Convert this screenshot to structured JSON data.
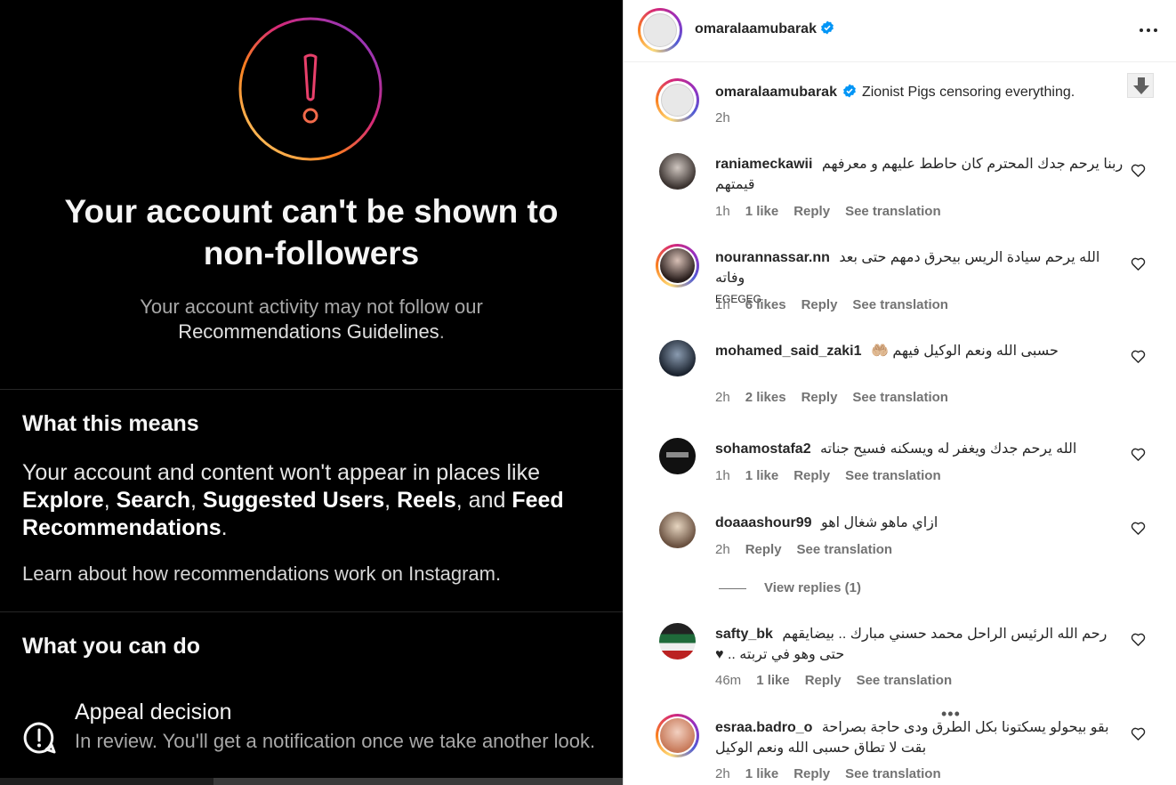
{
  "left": {
    "title": "Your account can't be shown to non-followers",
    "subtitle_prefix": "Your account activity may not follow our",
    "subtitle_link": "Recommendations Guidelines",
    "subtitle_suffix": ".",
    "means_heading": "What this means",
    "means_body_prefix": "Your account and content won't appear in places like",
    "means_places": [
      "Explore",
      "Search",
      "Suggested Users",
      "Reels",
      "Feed Recommendations"
    ],
    "means_sep1": ", ",
    "means_and": ", and ",
    "means_end": ".",
    "learn_text": "Learn about how recommendations work on Instagram.",
    "cando_heading": "What you can do",
    "appeal_title": "Appeal decision",
    "appeal_desc": "In review. You'll get a notification once we take another look."
  },
  "post": {
    "author": "omaralaamubarak",
    "caption": "Zionist Pigs censoring everything.",
    "time": "2h"
  },
  "comments": [
    {
      "user": "raniameckawii",
      "text": "ربنا يرحم جدك المحترم كان حاطط عليهم و معرفهم قيمتهم",
      "time": "1h",
      "likes": "1 like",
      "reply": "Reply",
      "translate": "See translation"
    },
    {
      "user": "nourannassar.nn",
      "text": "الله يرحم سيادة الريس بيحرق دمهم حتى بعد وفاته",
      "tail": "EGEGEG",
      "time": "1h",
      "likes": "6 likes",
      "reply": "Reply",
      "translate": "See translation"
    },
    {
      "user": "mohamed_said_zaki1",
      "text": "حسبى الله ونعم الوكيل فيهم",
      "emoji": "🤲🏼",
      "time": "2h",
      "likes": "2 likes",
      "reply": "Reply",
      "translate": "See translation"
    },
    {
      "user": "sohamostafa2",
      "text": "الله يرحم جدك ويغفر له ويسكنه فسيح جناته",
      "time": "1h",
      "likes": "1 like",
      "reply": "Reply",
      "translate": "See translation"
    },
    {
      "user": "doaaashour99",
      "text": "ازاي ماهو شغال اهو",
      "time": "2h",
      "reply": "Reply",
      "translate": "See translation"
    },
    {
      "user": "safty_bk",
      "text": "رحم الله الرئيس الراحل محمد حسني مبارك .. بيضايقهم حتى وهو في تربته .. ♥",
      "time": "46m",
      "likes": "1 like",
      "reply": "Reply",
      "translate": "See translation"
    },
    {
      "user": "esraa.badro_o",
      "text": "بقو بيحولو يسكتونا بكل الطرق ودى حاجة بصراحة بقت لا تطاق حسبى الله ونعم الوكيل",
      "time": "2h",
      "likes": "1 like",
      "reply": "Reply",
      "translate": "See translation"
    }
  ],
  "view_replies": "View replies (1)",
  "colors": {
    "verified": "#0095f6",
    "meta": "#737373",
    "left_bg": "#000000"
  }
}
